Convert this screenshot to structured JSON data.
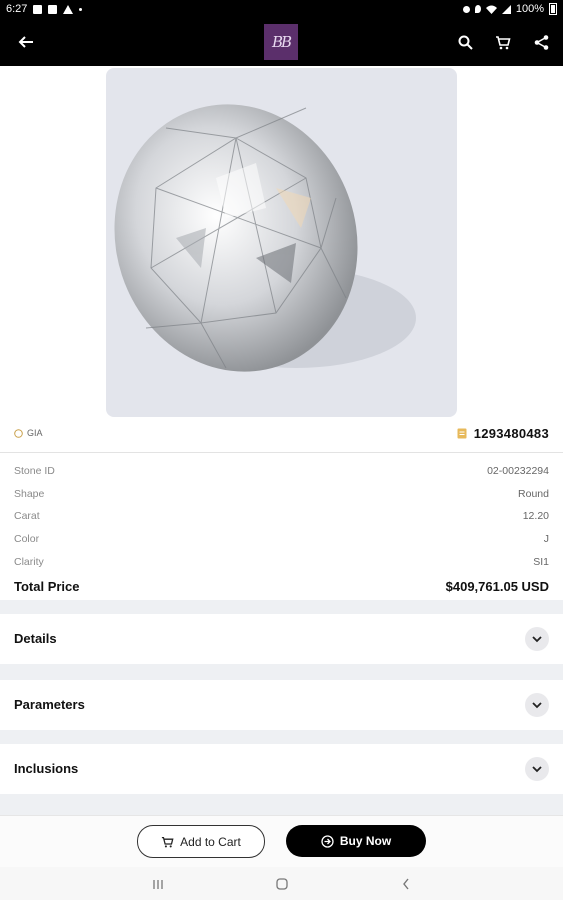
{
  "status_bar": {
    "time": "6:27",
    "battery": "100%"
  },
  "app_bar": {
    "logo_text": "BB",
    "icons": [
      "back-arrow-icon",
      "search-icon",
      "cart-icon",
      "share-icon"
    ]
  },
  "hero": {
    "image": "round diamond photo"
  },
  "certificate": {
    "lab": "GIA"
  },
  "stock_number": "1293480483",
  "specs": [
    {
      "label": "Stone ID",
      "value": "02-00232294"
    },
    {
      "label": "Shape",
      "value": "Round"
    },
    {
      "label": "Carat",
      "value": "12.20"
    },
    {
      "label": "Color",
      "value": "J"
    },
    {
      "label": "Clarity",
      "value": "SI1"
    }
  ],
  "total": {
    "label": "Total Price",
    "value": "$409,761.05 USD"
  },
  "sections": [
    {
      "label": "Details"
    },
    {
      "label": "Parameters"
    },
    {
      "label": "Inclusions"
    }
  ],
  "actions": {
    "add_to_cart": "Add to Cart",
    "buy_now": "Buy Now"
  },
  "colors": {
    "brand": "#5b2f6b",
    "appbar": "#000000",
    "section_gap": "#eef0f3",
    "accent_gold": "#d9a441"
  }
}
